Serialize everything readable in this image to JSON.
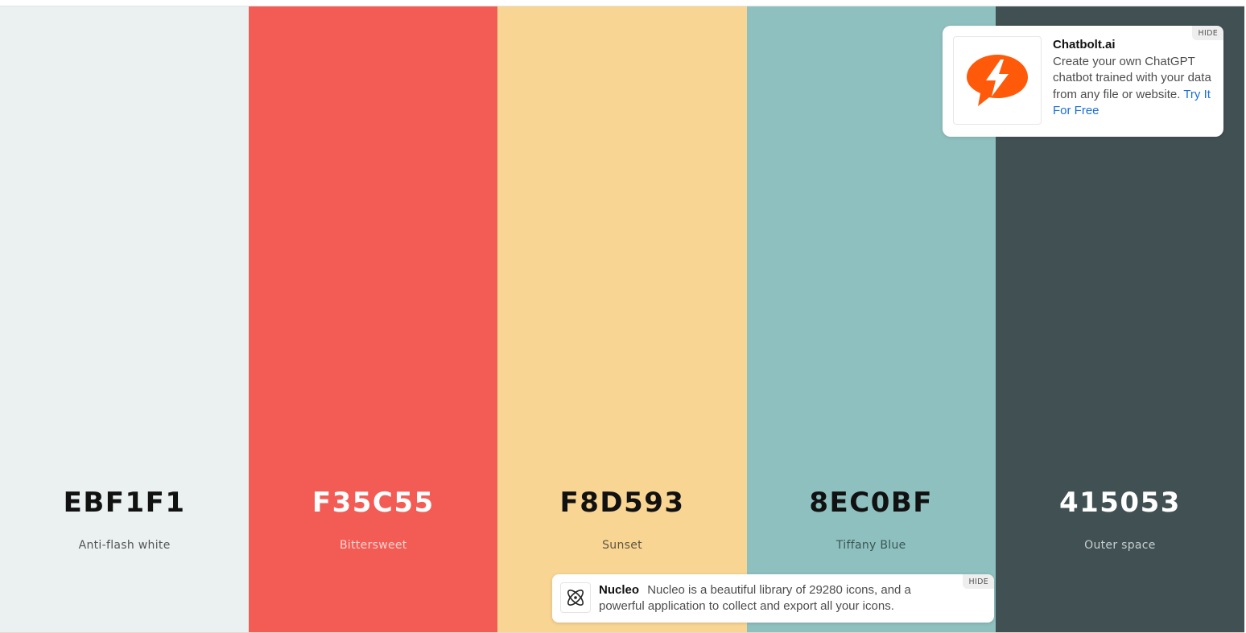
{
  "palette": [
    {
      "hex": "EBF1F1",
      "name": "Anti-flash white",
      "bg": "#EBF1F1",
      "hex_color": "#111111",
      "name_color": "#555555"
    },
    {
      "hex": "F35C55",
      "name": "Bittersweet",
      "bg": "#F35C55",
      "hex_color": "#FFFFFF",
      "name_color": "#FBD3D0"
    },
    {
      "hex": "F8D593",
      "name": "Sunset",
      "bg": "#F8D593",
      "hex_color": "#111111",
      "name_color": "#5E5540"
    },
    {
      "hex": "8EC0BF",
      "name": "Tiffany Blue",
      "bg": "#8EC0BF",
      "hex_color": "#111111",
      "name_color": "#3B5655"
    },
    {
      "hex": "415053",
      "name": "Outer space",
      "bg": "#415053",
      "hex_color": "#FFFFFF",
      "name_color": "#C9CFD0"
    }
  ],
  "ad": {
    "title": "Chatbolt.ai",
    "body": "Create your own ChatGPT chatbot trained with your data from any file or website.",
    "cta": "Try It For Free",
    "hide_label": "HIDE",
    "logo_icon": "chatbolt-lightning-bubble-icon",
    "logo_color": "#FF5A0A"
  },
  "banner": {
    "title": "Nucleo",
    "body": "Nucleo is a beautiful library of 29280 icons, and a powerful application to collect and export all your icons.",
    "hide_label": "HIDE",
    "logo_icon": "atom-icon"
  }
}
